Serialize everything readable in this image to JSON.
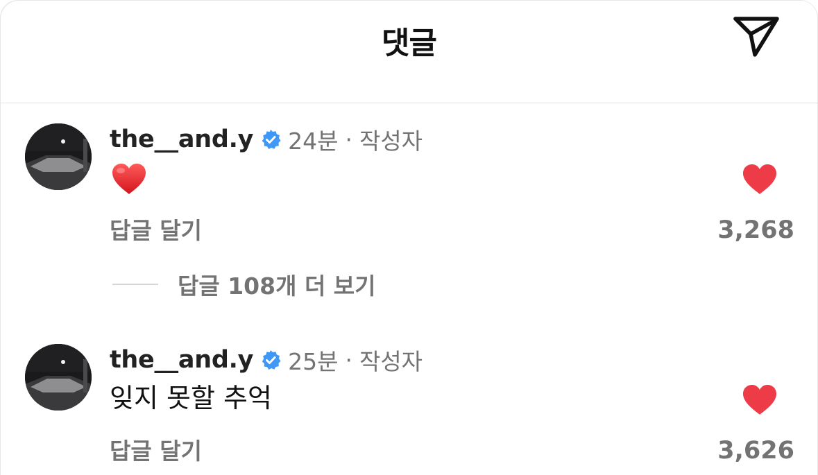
{
  "header": {
    "title": "댓글",
    "share_icon": "paper-plane-icon"
  },
  "comments": [
    {
      "username": "the__and.y",
      "verified": true,
      "time": "24분",
      "separator": "·",
      "badge": "작성자",
      "text": "",
      "emoji": "❤️",
      "reply_label": "답글 달기",
      "liked": true,
      "like_count": "3,268"
    },
    {
      "username": "the__and.y",
      "verified": true,
      "time": "25분",
      "separator": "·",
      "badge": "작성자",
      "text": "잊지 못할 추억",
      "reply_label": "답글 달기",
      "liked": true,
      "like_count": "3,626"
    }
  ],
  "view_replies": {
    "label": "답글 108개 더 보기"
  },
  "colors": {
    "like_red": "#ed3b47",
    "verified_blue": "#3f97f6",
    "secondary_text": "#737373",
    "divider": "#e3e3e3"
  }
}
